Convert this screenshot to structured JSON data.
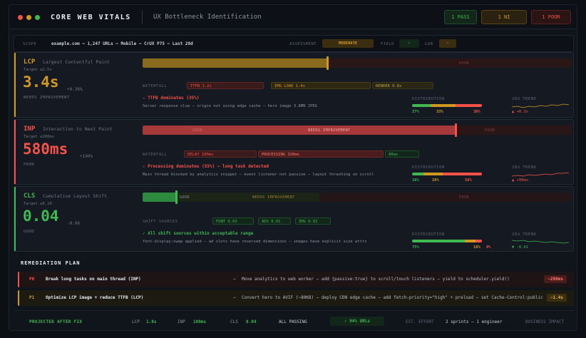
{
  "header": {
    "title": "CORE WEB VITALS",
    "subtitle": "UX Bottleneck Identification",
    "pass": "1 PASS",
    "ni": "1 NI",
    "poor": "1 POOR"
  },
  "scope": {
    "label": "SCOPE",
    "value": "example.com — 1,247 URLs — Mobile — CrUX P75 — Last 28d",
    "assessment_label": "ASSESSMENT",
    "assessment_value": "MODERATE",
    "field_label": "FIELD",
    "field_value": "✓",
    "lab_label": "LAB",
    "lab_value": "~"
  },
  "metrics": {
    "lcp": {
      "name": "LCP",
      "desc": "Largest Contentful Paint",
      "target": "Target ≤2.5s",
      "value": "3.4s",
      "delta": "+0.36%",
      "status": "NEEDS IMPROVEMENT",
      "zone_poor": "POOR",
      "waterfall_label": "WATERFALL",
      "seg1": "TTFB 1.2s",
      "seg2": "IMG LOAD 1.4s",
      "seg3": "RENDER 0.8s",
      "alert": "⚠ TTFB dominates (35%)",
      "alert_detail": "Server response slow — origin not using edge cache — hero image 3.8MB JPEG",
      "dist_label": "DISTRIBUTION",
      "dist_good": "27%",
      "dist_ni": "33%",
      "dist_poor": "38%",
      "trend_label": "28d TREND",
      "trend_delta": "▲ +0.3s"
    },
    "inp": {
      "name": "INP",
      "desc": "Interaction to Next Paint",
      "target": "Target ≤200ms",
      "value": "580ms",
      "delta": "+190%",
      "status": "POOR",
      "zone_good": "GOOD",
      "zone_ni": "NEEDS IMPROVEMENT",
      "zone_poor": "POOR",
      "waterfall_label": "WATERFALL",
      "seg1": "DELAY 180ms",
      "seg2": "PROCESSING 320ms",
      "seg3": "80ms",
      "alert": "⚠ Processing dominates (55%) — long task detected",
      "alert_detail": "Main thread blocked by analytics snippet — event listener not passive — layout thrashing on scroll",
      "dist_label": "DISTRIBUTION",
      "dist_good": "16%",
      "dist_ni": "28%",
      "dist_poor": "56%",
      "trend_label": "28d TREND",
      "trend_delta": "▲ +90ms"
    },
    "cls": {
      "name": "CLS",
      "desc": "Cumulative Layout Shift",
      "target": "Target ≤0.10",
      "value": "0.04",
      "delta": "-0.06",
      "status": "GOOD",
      "zone_good": "GOOD",
      "zone_ni": "NEEDS IMPROVEMENT",
      "zone_poor": "POOR",
      "sources_label": "SHIFT SOURCES",
      "seg1": "FONT 0.02",
      "seg2": "ADS 0.01",
      "seg3": "IMG 0.01",
      "alert": "✓ All shift sources within acceptable range",
      "alert_detail": "font-display:swap applied — ad slots have reserved dimensions — images have explicit size attrs",
      "dist_label": "DISTRIBUTION",
      "dist_good": "75%",
      "dist_ni": "16%",
      "dist_poor": "9%",
      "trend_label": "28d TREND",
      "trend_delta": "▼ -0.01"
    }
  },
  "plan": {
    "title": "REMEDIATION PLAN",
    "items": [
      {
        "rank": "P0",
        "title": "Break long tasks on main thread (INP)",
        "arrow": "→",
        "detail": "Move analytics to web worker — add {passive:true} to scroll/touch listeners — yield to scheduler.yield()",
        "gain": "−280ms"
      },
      {
        "rank": "P1",
        "title": "Optimize LCP image + reduce TTFB (LCP)",
        "arrow": "→",
        "detail": "Convert hero to AVIF (~80KB) — deploy CDN edge cache — add fetch-priority=\"high\" + preload — set Cache-Control:public",
        "gain": "−1.4s"
      }
    ]
  },
  "footer": {
    "projected": "PROJECTED AFTER FIX",
    "lcp_label": "LCP",
    "lcp_value": "1.8s",
    "inp_label": "INP",
    "inp_value": "180ms",
    "cls_label": "CLS",
    "cls_value": "0.04",
    "all_passing": "ALL PASSING",
    "urls": "✓ 94% URLs",
    "effort_label": "EST. EFFORT",
    "effort_value": "2 sprints — 1 engineer",
    "impact_label": "BUSINESS IMPACT"
  },
  "colors": {
    "good": "#3fb950",
    "ni": "#d29922",
    "poor": "#f85149"
  }
}
